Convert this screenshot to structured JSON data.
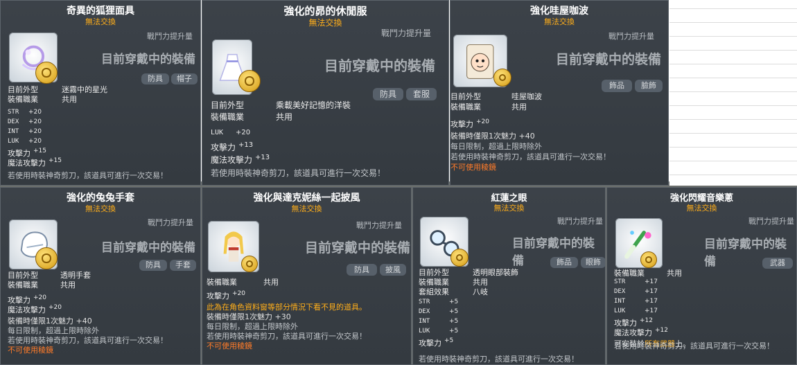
{
  "cards": [
    {
      "title": "奇異的狐狸面具",
      "trade": "無法交換",
      "power_label": "戰鬥力提升量",
      "equipped": "目前穿戴中的裝備",
      "tags": [
        "防具",
        "帽子"
      ],
      "icon": "fox-mask-icon",
      "info": [
        {
          "label": "目前外型",
          "value": "迷霧中的星光"
        },
        {
          "label": "裝備職業",
          "value": "共用"
        }
      ],
      "stats": [
        {
          "name": "STR",
          "value": "+20"
        },
        {
          "name": "DEX",
          "value": "+20"
        },
        {
          "name": "INT",
          "value": "+20"
        },
        {
          "name": "LUK",
          "value": "+20"
        },
        {
          "name": "攻擊力",
          "value": "+15"
        },
        {
          "name": "魔法攻擊力",
          "value": "+15"
        }
      ],
      "notes": [
        "若使用時裝神奇剪刀，該道具可進行一次交易！"
      ]
    },
    {
      "title": "強化的昴的休閒服",
      "trade": "無法交換",
      "power_label": "戰鬥力提升量",
      "equipped": "目前穿戴中的裝備",
      "tags": [
        "防具",
        "套服"
      ],
      "icon": "dress-icon",
      "info": [
        {
          "label": "目前外型",
          "value": "乘載美好記憶的洋裝"
        },
        {
          "label": "裝備職業",
          "value": "共用"
        }
      ],
      "stats": [
        {
          "name": "LUK",
          "value": "+20"
        },
        {
          "name": "攻擊力",
          "value": "+13"
        },
        {
          "name": "魔法攻擊力",
          "value": "+13"
        }
      ],
      "notes": [
        "若使用時裝神奇剪刀，該道具可進行一次交易！"
      ]
    },
    {
      "title": "強化哇屋咖波",
      "trade": "無法交換",
      "power_label": "戰鬥力提升量",
      "equipped": "目前穿戴中的裝備",
      "tags": [
        "飾品",
        "臉飾"
      ],
      "icon": "face-mask-icon",
      "info": [
        {
          "label": "目前外型",
          "value": "哇屋咖波"
        },
        {
          "label": "裝備職業",
          "value": "共用"
        }
      ],
      "stats": [
        {
          "name": "攻擊力",
          "value": "+20"
        }
      ],
      "extra": [
        {
          "text": "裝備時僅限1次魅力 +40",
          "style": "note"
        },
        {
          "text": "每日限制，超過上限時除外",
          "style": "muted"
        },
        {
          "text": "若使用時裝神奇剪刀，該道具可進行一次交易！",
          "style": "muted"
        },
        {
          "text": "不可使用稜鏡",
          "style": "red"
        }
      ]
    },
    {
      "title": "強化的兔兔手套",
      "trade": "無法交換",
      "power_label": "戰鬥力提升量",
      "equipped": "目前穿戴中的裝備",
      "tags": [
        "防具",
        "手套"
      ],
      "icon": "glove-icon",
      "info": [
        {
          "label": "目前外型",
          "value": "透明手套"
        },
        {
          "label": "裝備職業",
          "value": "共用"
        }
      ],
      "stats": [
        {
          "name": "攻擊力",
          "value": "+20"
        },
        {
          "name": "魔法攻擊力",
          "value": "+20"
        }
      ],
      "extra": [
        {
          "text": "裝備時僅限1次魅力 +40",
          "style": "note"
        },
        {
          "text": "每日限制，超過上限時除外",
          "style": "muted"
        },
        {
          "text": "若使用時裝神奇剪刀，該道具可進行一次交易！",
          "style": "muted"
        },
        {
          "text": "不可使用稜鏡",
          "style": "red"
        }
      ]
    },
    {
      "title": "強化與達克妮絲一起披風",
      "trade": "無法交換",
      "power_label": "戰鬥力提升量",
      "equipped": "目前穿戴中的裝備",
      "tags": [
        "防具",
        "披風"
      ],
      "icon": "character-icon",
      "info": [
        {
          "label": "裝備職業",
          "value": "共用"
        }
      ],
      "stats": [
        {
          "name": "攻擊力",
          "value": "+20"
        }
      ],
      "extra": [
        {
          "text": "此為在角色資料窗等部分情況下看不見的道具。",
          "style": "orange"
        },
        {
          "text": "裝備時僅限1次魅力 +30",
          "style": "note"
        },
        {
          "text": "每日限制，超過上限時除外",
          "style": "muted"
        },
        {
          "text": "若使用時裝神奇剪刀，該道具可進行一次交易！",
          "style": "muted"
        },
        {
          "text": "不可使用稜鏡",
          "style": "red"
        }
      ]
    },
    {
      "title": "紅蓮之眼",
      "trade": "無法交換",
      "power_label": "戰鬥力提升量",
      "equipped": "目前穿戴中的裝備",
      "tags": [
        "飾品",
        "眼飾"
      ],
      "icon": "glasses-icon",
      "info": [
        {
          "label": "目前外型",
          "value": "透明眼部裝飾"
        },
        {
          "label": "裝備職業",
          "value": "共用"
        },
        {
          "label": "套組效果",
          "value": "八岐"
        }
      ],
      "stats": [
        {
          "name": "STR",
          "value": "+5"
        },
        {
          "name": "DEX",
          "value": "+5"
        },
        {
          "name": "INT",
          "value": "+5"
        },
        {
          "name": "LUK",
          "value": "+5"
        },
        {
          "name": "攻擊力",
          "value": "+5"
        }
      ],
      "notes": [
        "若使用時裝神奇剪刀，該道具可進行一次交易！"
      ]
    },
    {
      "title": "強化閃耀音樂蔥",
      "trade": "無法交換",
      "power_label": "戰鬥力提升量",
      "equipped": "目前穿戴中的裝備",
      "tags": [
        "武器"
      ],
      "icon": "leek-weapon-icon",
      "info": [
        {
          "label": "裝備職業",
          "value": "共用"
        }
      ],
      "stats": [
        {
          "name": "STR",
          "value": "+17"
        },
        {
          "name": "DEX",
          "value": "+17"
        },
        {
          "name": "INT",
          "value": "+17"
        },
        {
          "name": "LUK",
          "value": "+17"
        },
        {
          "name": "攻擊力",
          "value": "+12"
        },
        {
          "name": "魔法攻擊力",
          "value": "+12"
        }
      ],
      "equip_note": {
        "pre": "可安裝於",
        "highlight": "所有武器",
        "post": "上。"
      },
      "notes": [
        "若使用時裝神奇剪刀，該道具可進行一次交易！"
      ]
    }
  ]
}
